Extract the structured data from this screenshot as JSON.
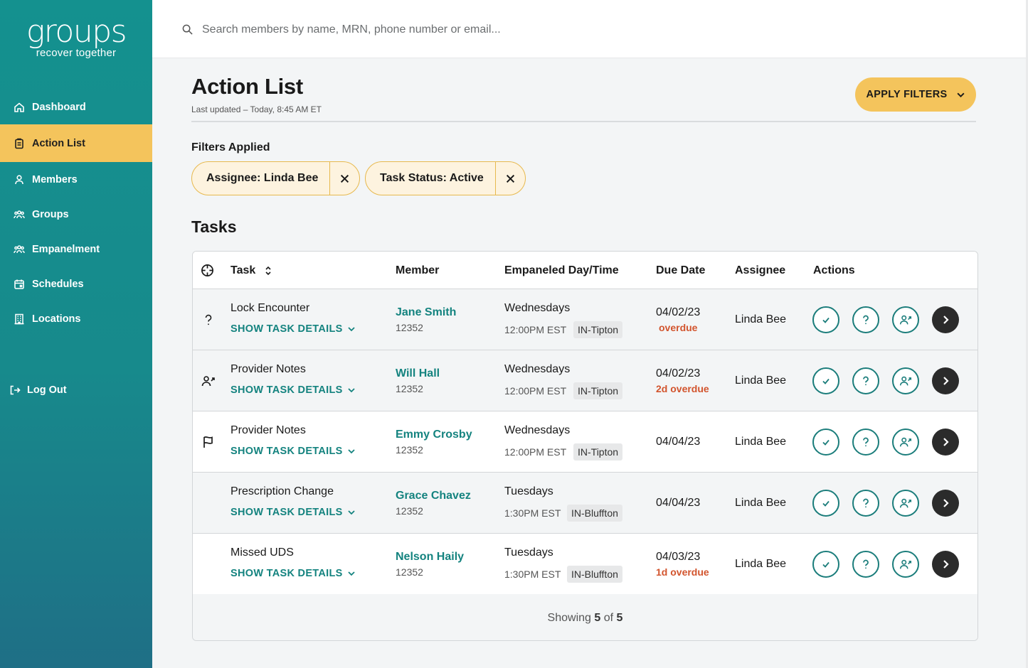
{
  "app": {
    "logo_word": "groups",
    "logo_tagline": "recover together"
  },
  "sidebar": {
    "items": [
      {
        "label": "Dashboard",
        "icon": "home-icon"
      },
      {
        "label": "Action List",
        "icon": "clipboard-icon",
        "active": true
      },
      {
        "label": "Members",
        "icon": "person-icon"
      },
      {
        "label": "Groups",
        "icon": "people-group-icon"
      },
      {
        "label": "Empanelment",
        "icon": "people-group-icon"
      },
      {
        "label": "Schedules",
        "icon": "calendar-icon"
      },
      {
        "label": "Locations",
        "icon": "building-icon"
      }
    ],
    "logout_label": "Log Out"
  },
  "search": {
    "placeholder": "Search members by name, MRN, phone number or email..."
  },
  "page": {
    "title": "Action List",
    "last_updated": "Last updated – Today, 8:45 AM ET",
    "apply_filters_label": "APPLY FILTERS"
  },
  "filters": {
    "label": "Filters Applied",
    "chips": [
      "Assignee: Linda Bee",
      "Task Status: Active"
    ]
  },
  "tasks": {
    "title": "Tasks",
    "columns": {
      "task": "Task",
      "member": "Member",
      "empaneled": "Empaneled Day/Time",
      "due_date": "Due Date",
      "assignee": "Assignee",
      "actions": "Actions"
    },
    "show_details_label": "SHOW TASK DETAILS",
    "rows": [
      {
        "icon": "question-icon",
        "task": "Lock Encounter",
        "member": "Jane Smith",
        "member_id": "12352",
        "day": "Wednesdays",
        "time": "12:00PM EST",
        "location": "IN-Tipton",
        "due": "04/02/23",
        "overdue": "overdue",
        "assignee": "Linda Bee"
      },
      {
        "icon": "person-arrow-icon",
        "task": "Provider Notes",
        "member": "Will Hall",
        "member_id": "12352",
        "day": "Wednesdays",
        "time": "12:00PM EST",
        "location": "IN-Tipton",
        "due": "04/02/23",
        "overdue": "2d overdue",
        "assignee": "Linda Bee"
      },
      {
        "icon": "flag-icon",
        "task": "Provider Notes",
        "member": "Emmy Crosby",
        "member_id": "12352",
        "day": "Wednesdays",
        "time": "12:00PM EST",
        "location": "IN-Tipton",
        "due": "04/04/23",
        "overdue": "",
        "assignee": "Linda Bee"
      },
      {
        "icon": "",
        "task": "Prescription Change",
        "member": "Grace Chavez",
        "member_id": "12352",
        "day": "Tuesdays",
        "time": "1:30PM EST",
        "location": "IN-Bluffton",
        "due": "04/04/23",
        "overdue": "",
        "assignee": "Linda Bee"
      },
      {
        "icon": "",
        "task": "Missed UDS",
        "member": "Nelson Haily",
        "member_id": "12352",
        "day": "Tuesdays",
        "time": "1:30PM EST",
        "location": "IN-Bluffton",
        "due": "04/03/23",
        "overdue": "1d overdue",
        "assignee": "Linda Bee"
      }
    ],
    "footer": {
      "prefix": "Showing",
      "shown": "5",
      "of": "of",
      "total": "5"
    }
  },
  "colors": {
    "sidebar_teal": "#14918f",
    "accent_yellow": "#f4c45c",
    "link_teal": "#14837f",
    "overdue_red": "#d2542d"
  }
}
